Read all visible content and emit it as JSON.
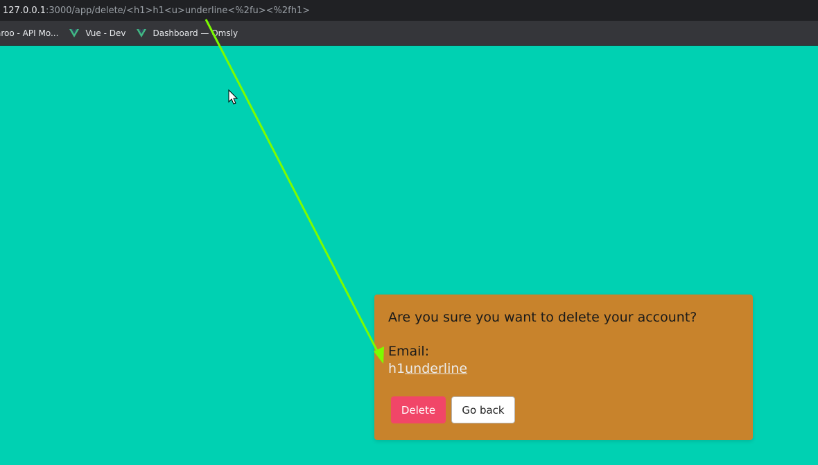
{
  "browser": {
    "url_host": "127.0.0.1",
    "url_path": ":3000/app/delete/<h1>h1<u>underline<%2fu><%2fh1>",
    "bookmarks": [
      {
        "label": "aroo - API Mo..."
      },
      {
        "label": "Vue - Dev",
        "icon": "vue-icon"
      },
      {
        "label": "Dashboard — Omsly",
        "icon": "vue-icon"
      }
    ]
  },
  "page": {
    "background_color": "#00d1b2"
  },
  "modal": {
    "question": "Are you sure you want to delete your account?",
    "email_label": "Email:",
    "email_plain": "h1",
    "email_underlined": "underline",
    "delete_label": "Delete",
    "back_label": "Go back",
    "background_color": "#c8832c",
    "delete_color": "#f14668"
  },
  "annotation": {
    "arrow_color": "#7cfc00",
    "cursor": "mouse-pointer-icon"
  }
}
